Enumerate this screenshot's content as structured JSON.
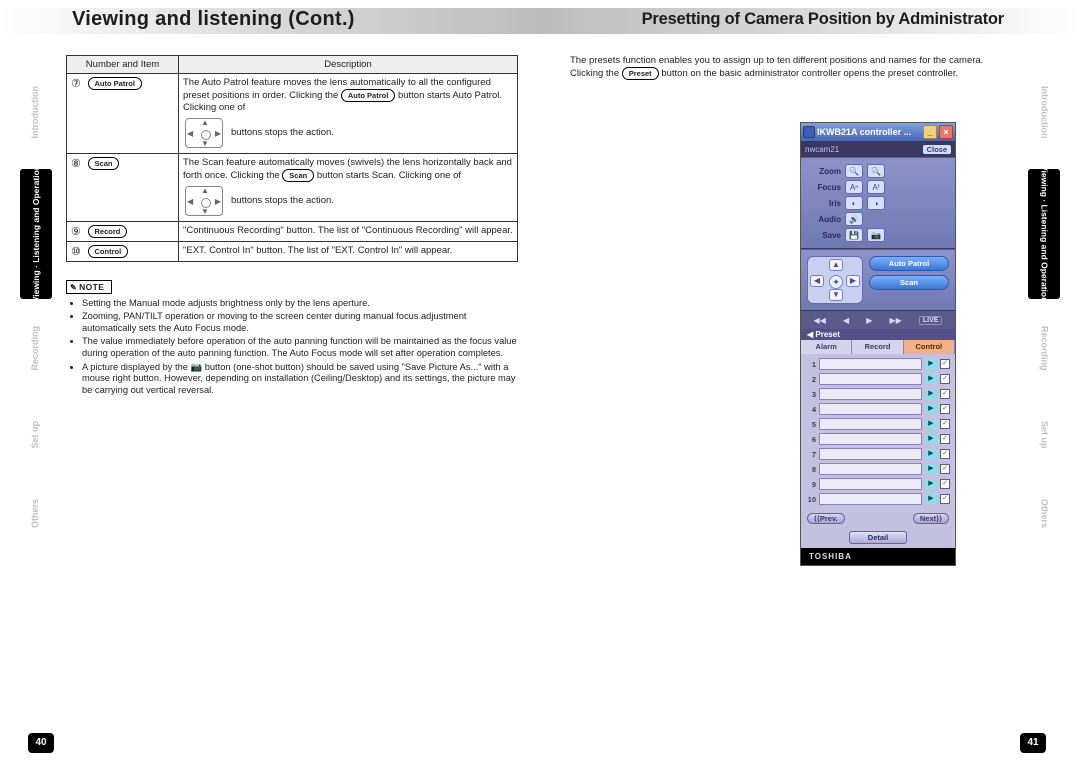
{
  "titlebars": {
    "left": "Viewing and listening (Cont.)",
    "right": "Presetting of Camera Position by Administrator"
  },
  "tabs": {
    "items": [
      {
        "label": "Introduction",
        "active": false,
        "cls": "t-intro"
      },
      {
        "label": "Viewing · Listening\nand Operation",
        "active": true,
        "cls": "t-view"
      },
      {
        "label": "Recording",
        "active": false,
        "cls": "t-rec"
      },
      {
        "label": "Set up",
        "active": false,
        "cls": "t-setup"
      },
      {
        "label": "Others",
        "active": false,
        "cls": "t-others"
      }
    ]
  },
  "table": {
    "headers": {
      "col1": "Number and Item",
      "col2": "Description"
    },
    "rows": [
      {
        "num": "⑦",
        "btn": "Auto Patrol",
        "desc_a": "The Auto Patrol feature moves the lens automatically to all the configured preset positions in order. Clicking the ",
        "desc_btn": "Auto Patrol",
        "desc_b": " button starts Auto Patrol. Clicking one of",
        "after_pad": "buttons stops the action."
      },
      {
        "num": "⑧",
        "btn": "Scan",
        "desc_a": "The Scan feature automatically moves (swivels) the lens horizontally back and forth once. Clicking the ",
        "desc_btn": "Scan",
        "desc_b": " button starts Scan. Clicking one of",
        "after_pad": "buttons stops the action."
      },
      {
        "num": "⑨",
        "btn": "Record",
        "desc_a": "\"Continuous Recording\" button.  The list of \"Continuous Recording\" will appear.",
        "desc_btn": "",
        "desc_b": "",
        "after_pad": ""
      },
      {
        "num": "⑩",
        "btn": "Control",
        "desc_a": "\"EXT. Control In\" button.  The list of \"EXT. Control In\" will appear.",
        "desc_btn": "",
        "desc_b": "",
        "after_pad": ""
      }
    ]
  },
  "note": {
    "label": "NOTE",
    "items": [
      "Setting the Manual mode adjusts brightness only by the lens aperture.",
      "Zooming, PAN/TILT operation or moving to the screen center during manual focus adjustment automatically sets the Auto Focus mode.",
      "The value immediately before operation of the auto panning function will be maintained as the focus value during operation of the auto panning function. The Auto Focus mode will set after operation completes.",
      "A picture displayed by the 📷 button (one-shot button) should be saved using \"Save Picture As...\" with a mouse right button. However, depending on installation (Ceiling/Desktop) and its settings, the picture may be carrying out vertical reversal."
    ]
  },
  "right_intro": {
    "text_a": "The presets function enables you to assign up to ten different positions and names for the camera. Clicking the ",
    "btn": "Preset",
    "text_b": " button on the basic administrator controller opens the preset controller."
  },
  "controller": {
    "title": "IKWB21A controller ...",
    "camname": "nwcam21",
    "close": "Close",
    "rows": [
      {
        "label": "Zoom",
        "icon1": "🔍",
        "icon2": "🔍"
      },
      {
        "label": "Focus",
        "icon1": "Aⁿ",
        "icon2": "Aᶠ"
      },
      {
        "label": "Iris",
        "icon1": "◐",
        "icon2": "◑"
      },
      {
        "label": "Audio",
        "icon1": "🔊",
        "icon2": ""
      },
      {
        "label": "Save",
        "icon1": "💾",
        "icon2": "📷"
      }
    ],
    "autopatrol": "Auto Patrol",
    "scan": "Scan",
    "live": "LIVE",
    "preset": "Preset",
    "tabs": {
      "alarm": "Alarm",
      "record": "Record",
      "control": "Control"
    },
    "rows_count": 10,
    "prev": "⟨⟨Prev.",
    "next": "Next⟩⟩",
    "detail": "Detail",
    "brand": "TOSHIBA"
  },
  "pagenums": {
    "left": "40",
    "right": "41"
  }
}
